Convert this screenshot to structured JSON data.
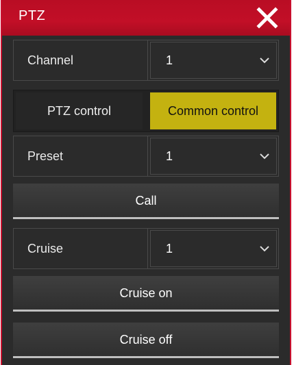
{
  "window": {
    "title": "PTZ"
  },
  "channel": {
    "label": "Channel",
    "value": "1"
  },
  "tabs": [
    {
      "label": "PTZ control",
      "active": false
    },
    {
      "label": "Common control",
      "active": true
    }
  ],
  "preset": {
    "label": "Preset",
    "value": "1"
  },
  "buttons": {
    "call": "Call",
    "cruise_on": "Cruise on",
    "cruise_off": "Cruise off"
  },
  "cruise": {
    "label": "Cruise",
    "value": "1"
  },
  "colors": {
    "title_bar": "#c20f27",
    "active_tab": "#c4b210",
    "panel_bg": "#2b2b2b"
  },
  "icons": {
    "close": "close-icon",
    "dropdown": "chevron-down-icon"
  }
}
